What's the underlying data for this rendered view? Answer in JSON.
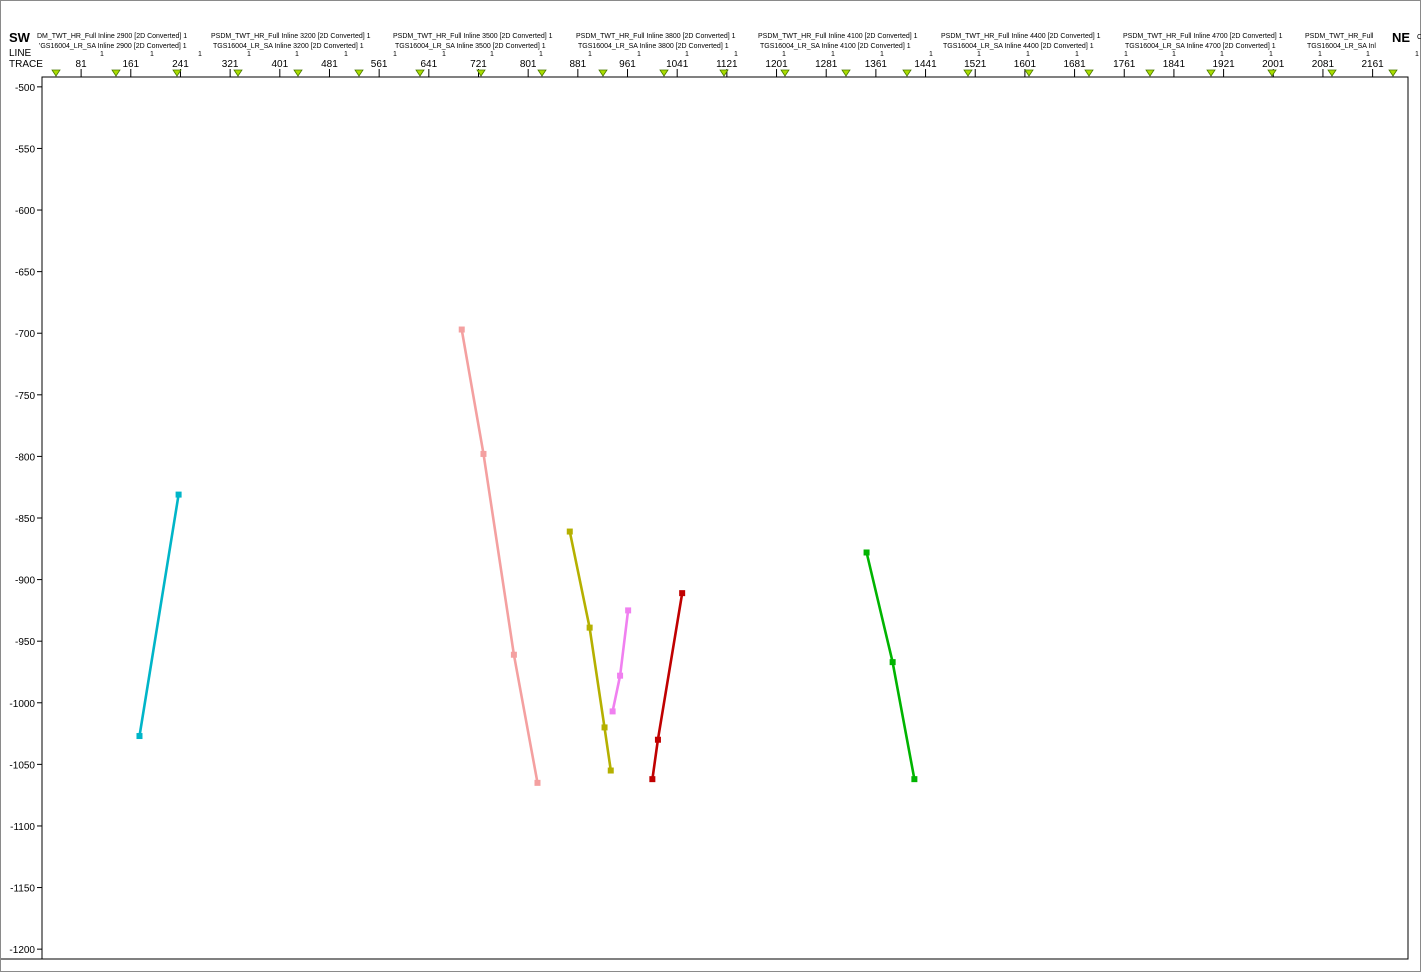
{
  "header": {
    "left_direction": "SW",
    "right_direction": "NE",
    "line_label": "LINE",
    "trace_label": "TRACE",
    "overflow_glyph": "C"
  },
  "sections": [
    {
      "row1": "DM_TWT_HR_Full Inline 2900 [2D Converted] 1",
      "row2": "'GS16004_LR_SA Inline 2900 [2D Converted] 1"
    },
    {
      "row1": "PSDM_TWT_HR_Full Inline 3200 [2D Converted] 1",
      "row2": "TGS16004_LR_SA Inline 3200 [2D Converted] 1"
    },
    {
      "row1": "PSDM_TWT_HR_Full Inline 3500 [2D Converted] 1",
      "row2": "TGS16004_LR_SA Inline 3500 [2D Converted] 1"
    },
    {
      "row1": "PSDM_TWT_HR_Full Inline 3800 [2D Converted] 1",
      "row2": "TGS16004_LR_SA Inline 3800 [2D Converted] 1"
    },
    {
      "row1": "PSDM_TWT_HR_Full Inline 4100 [2D Converted] 1",
      "row2": "TGS16004_LR_SA Inline 4100 [2D Converted] 1"
    },
    {
      "row1": "PSDM_TWT_HR_Full Inline 4400 [2D Converted] 1",
      "row2": "TGS16004_LR_SA Inline 4400 [2D Converted] 1"
    },
    {
      "row1": "PSDM_TWT_HR_Full Inline 4700 [2D Converted] 1",
      "row2": "TGS16004_LR_SA Inline 4700 [2D Converted] 1"
    },
    {
      "row1": "PSDM_TWT_HR_Full",
      "row2": "TGS16004_LR_SA Inl"
    }
  ],
  "line_values": [
    "1",
    "1",
    "1",
    "1",
    "1",
    "1",
    "1",
    "1",
    "1",
    "1",
    "1",
    "1",
    "1",
    "1",
    "1",
    "1",
    "1",
    "1",
    "1",
    "1",
    "1",
    "1",
    "1",
    "1",
    "1",
    "1",
    "1",
    "1"
  ],
  "trace_marker_color": "#aadd00",
  "chart_data": {
    "type": "line",
    "xlabel": "TRACE",
    "ylabel": "",
    "x_ticks": [
      81,
      161,
      241,
      321,
      401,
      481,
      561,
      641,
      721,
      801,
      881,
      961,
      1041,
      1121,
      1201,
      1281,
      1361,
      1441,
      1521,
      1601,
      1681,
      1761,
      1841,
      1921,
      2001,
      2081,
      2161
    ],
    "xlim": [
      18,
      2218
    ],
    "y_ticks": [
      -500,
      -550,
      -600,
      -650,
      -700,
      -750,
      -800,
      -850,
      -900,
      -950,
      -1000,
      -1050,
      -1100,
      -1150,
      -1200
    ],
    "ylim": [
      -1208,
      -492
    ],
    "grid": false,
    "series": [
      {
        "color": "#00b5c8",
        "points": [
          [
            175,
            -1027
          ],
          [
            238,
            -831
          ]
        ]
      },
      {
        "color": "#f4a0a0",
        "points": [
          [
            694,
            -697
          ],
          [
            729,
            -798
          ],
          [
            778,
            -961
          ],
          [
            816,
            -1065
          ]
        ]
      },
      {
        "color": "#b5b000",
        "points": [
          [
            868,
            -861
          ],
          [
            900,
            -939
          ],
          [
            924,
            -1020
          ],
          [
            934,
            -1055
          ]
        ]
      },
      {
        "color": "#f080f0",
        "points": [
          [
            937,
            -1007
          ],
          [
            949,
            -978
          ],
          [
            962,
            -925
          ]
        ]
      },
      {
        "color": "#c00000",
        "points": [
          [
            1001,
            -1062
          ],
          [
            1010,
            -1030
          ],
          [
            1049,
            -911
          ]
        ]
      },
      {
        "color": "#00b400",
        "points": [
          [
            1346,
            -878
          ],
          [
            1388,
            -967
          ],
          [
            1423,
            -1062
          ]
        ]
      }
    ]
  }
}
